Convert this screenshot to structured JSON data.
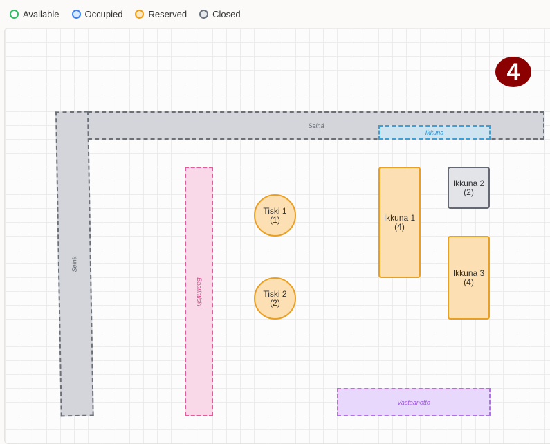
{
  "legend": [
    {
      "label": "Available",
      "color": "#22c55e"
    },
    {
      "label": "Occupied",
      "color": "#3b82f6"
    },
    {
      "label": "Reserved",
      "color": "#f59e0b"
    },
    {
      "label": "Closed",
      "color": "#6b7280"
    }
  ],
  "floor": {
    "number_badge": "4",
    "zones": {
      "wall_top": "Seinä",
      "window_strip": "Ikkuna",
      "wall_left": "Seinä",
      "bar_counter": "Baarintiski",
      "reception": "Vastaanotto"
    },
    "tables": [
      {
        "name": "Tiski 1",
        "seats": "(1)",
        "status": "Reserved"
      },
      {
        "name": "Tiski 2",
        "seats": "(2)",
        "status": "Reserved"
      },
      {
        "name": "Ikkuna 1",
        "seats": "(4)",
        "status": "Reserved"
      },
      {
        "name": "Ikkuna 2",
        "seats": "(2)",
        "status": "Closed"
      },
      {
        "name": "Ikkuna 3",
        "seats": "(4)",
        "status": "Reserved"
      }
    ]
  }
}
